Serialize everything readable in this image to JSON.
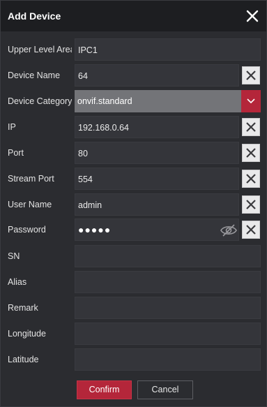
{
  "dialog": {
    "title": "Add Device"
  },
  "fields": {
    "upper_level_area": {
      "label": "Upper Level Area",
      "value": "IPC1"
    },
    "device_name": {
      "label": "Device Name",
      "value": "64"
    },
    "device_category": {
      "label": "Device Category",
      "value": "onvif.standard"
    },
    "ip": {
      "label": "IP",
      "value": "192.168.0.64"
    },
    "port": {
      "label": "Port",
      "value": "80"
    },
    "stream_port": {
      "label": "Stream Port",
      "value": "554"
    },
    "user_name": {
      "label": "User Name",
      "value": "admin"
    },
    "password": {
      "label": "Password",
      "value": "●●●●●"
    },
    "sn": {
      "label": "SN",
      "value": ""
    },
    "alias": {
      "label": "Alias",
      "value": ""
    },
    "remark": {
      "label": "Remark",
      "value": ""
    },
    "longitude": {
      "label": "Longitude",
      "value": ""
    },
    "latitude": {
      "label": "Latitude",
      "value": ""
    }
  },
  "buttons": {
    "confirm": "Confirm",
    "cancel": "Cancel"
  },
  "icons": {
    "close": "close-icon",
    "clear": "clear-icon",
    "dropdown": "chevron-down-icon",
    "password_visibility": "eye-slash-icon"
  },
  "colors": {
    "accent": "#b4263a",
    "background": "#2b2c30",
    "titlebar": "#1d1e21",
    "field": "#34353a",
    "select": "#737478"
  }
}
